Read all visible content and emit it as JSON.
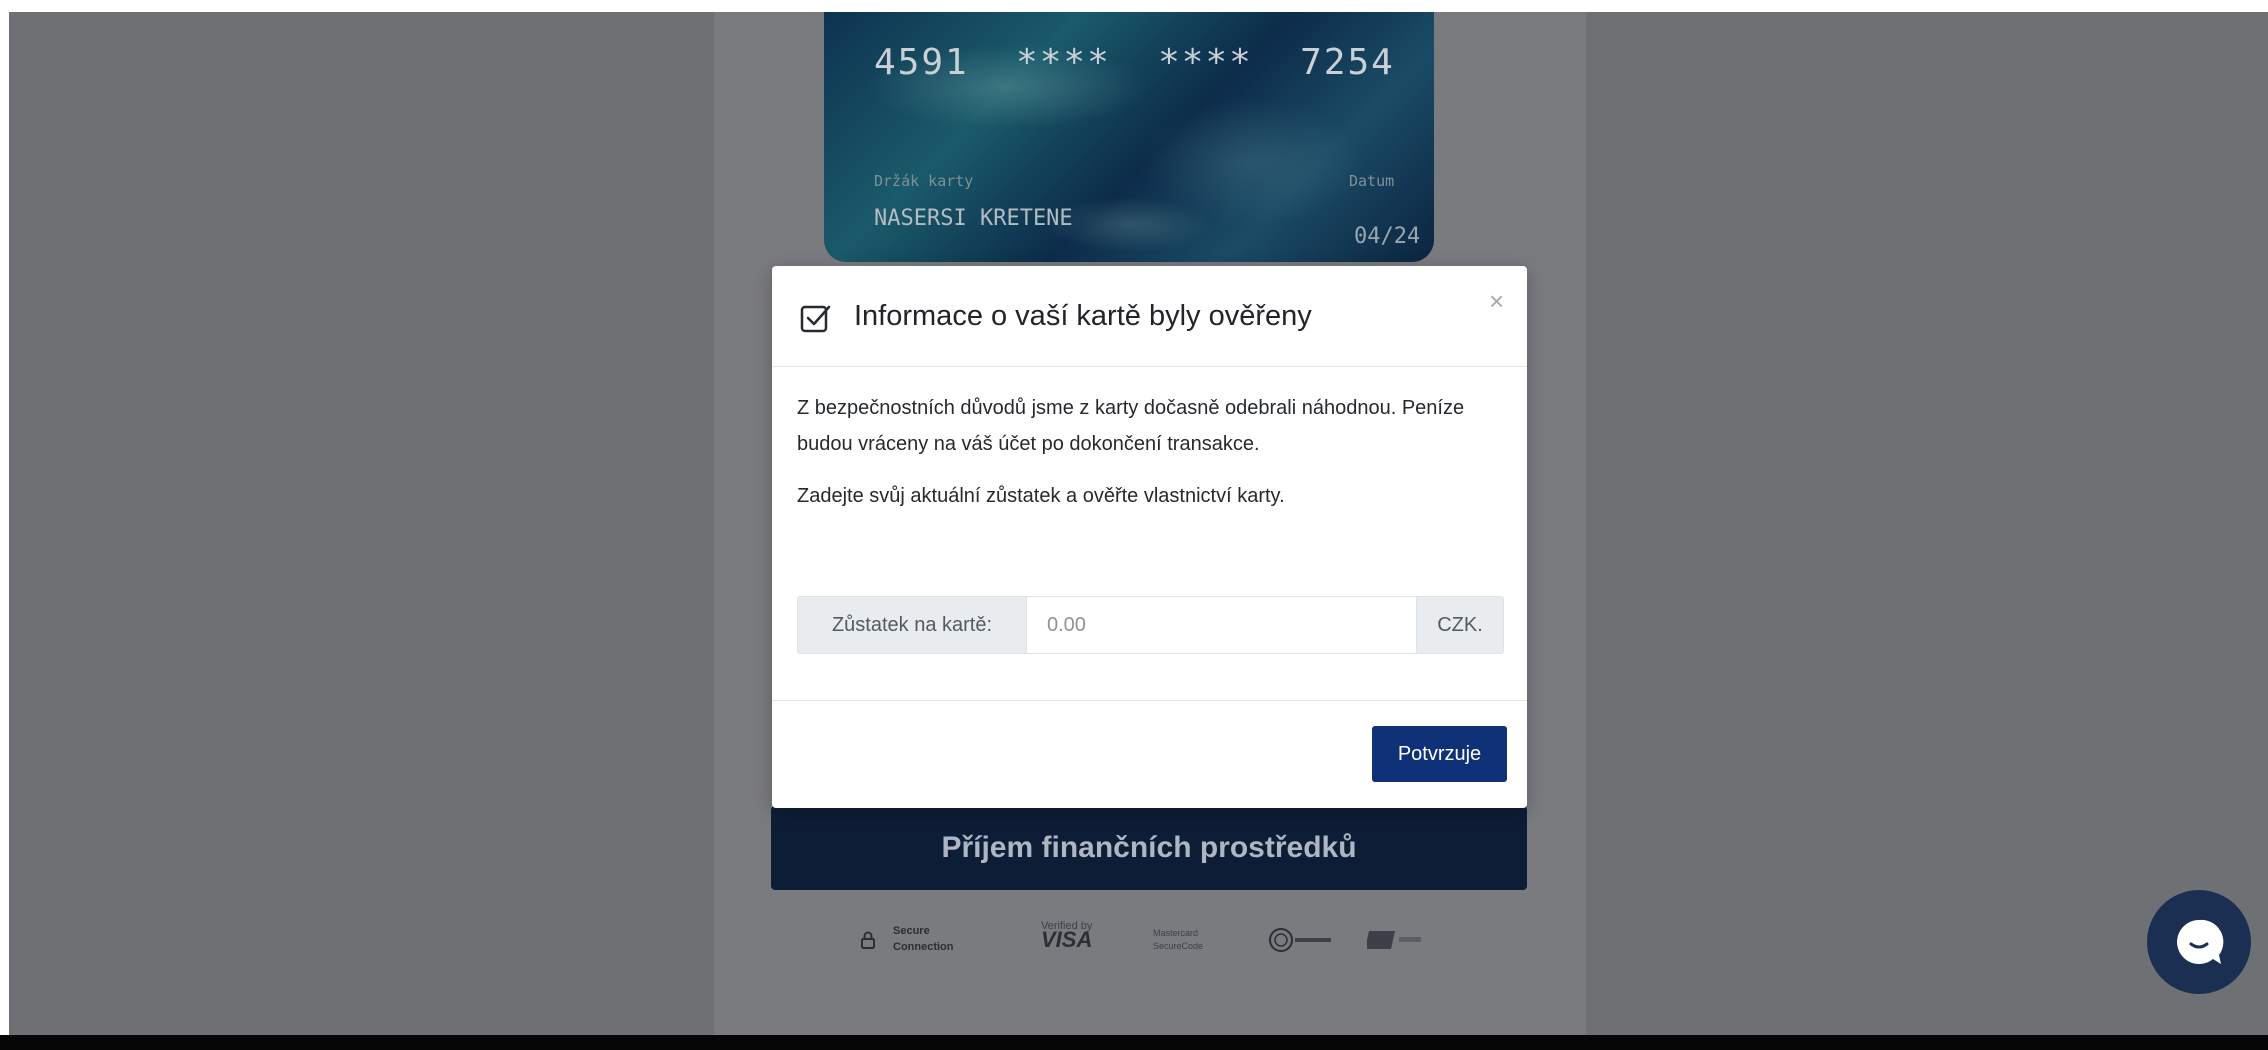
{
  "card": {
    "number": "4591  ****  ****  7254",
    "holder_label": "Držák karty",
    "holder_name": "NASERSI KRETENE",
    "date_label": "Datum",
    "expiry": "04/24"
  },
  "modal": {
    "title": "Informace o vaší kartě byly ověřeny",
    "close_symbol": "×",
    "paragraph1": "Z bezpečnostních důvodů jsme z karty dočasně odebrali náhodnou. Peníze budou vráceny na váš účet po dokončení transakce.",
    "paragraph2": "Zadejte svůj aktuální zůstatek a ověřte vlastnictví karty.",
    "balance_label": "Zůstatek na kartě:",
    "balance_placeholder": "0.00",
    "currency": "CZK.",
    "confirm_label": "Potvrzuje"
  },
  "page": {
    "receive_button_label": "Příjem finančních prostředků"
  },
  "badges": {
    "secure_line1": "Secure",
    "secure_line2": "Connection",
    "visa_small": "Verified by",
    "visa_big": "VISA",
    "mastercard_line1": "Mastercard",
    "mastercard_line2": "SecureCode"
  },
  "colors": {
    "overlay_bg": "#6f7074",
    "primary_button": "#0f3178",
    "receive_button": "#0e1d36",
    "chat_button": "#1b2f53"
  },
  "icons": {
    "check": "check-square-icon",
    "close": "close-icon",
    "lock": "lock-icon",
    "chat": "chat-bubble-icon"
  }
}
